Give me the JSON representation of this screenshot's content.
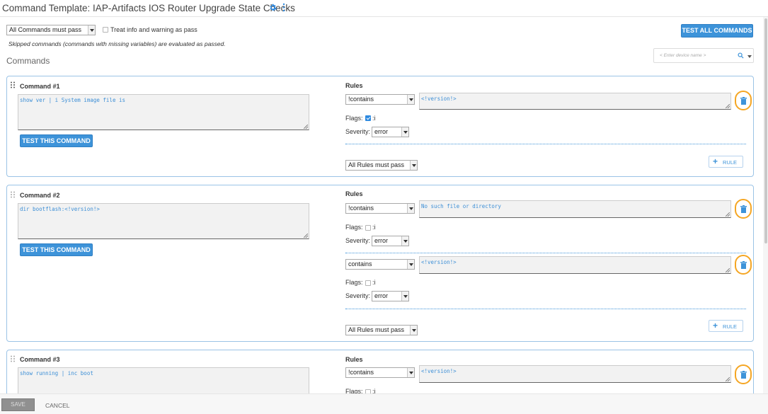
{
  "header": {
    "title": "Command Template: IAP-Artifacts IOS Router Upgrade State Checks"
  },
  "top_controls": {
    "pass_mode": "All Commands must pass",
    "treat_warning_label": "Treat info and warning as pass",
    "treat_warning_checked": false,
    "skipped_note": "Skipped commands (commands with missing variables) are evaluated as passed.",
    "test_all_label": "TEST ALL COMMANDS",
    "device_placeholder": "< Enter device name >"
  },
  "section_title": "Commands",
  "commands": [
    {
      "title": "Command #1",
      "command_text": "show ver | i System image file is",
      "test_label": "TEST THIS COMMAND",
      "rules_label": "Rules",
      "rules": [
        {
          "operator": "!contains",
          "value": "<!version!>",
          "flags_label": "Flags:",
          "flag_i_label": ":i",
          "flag_i_checked": true,
          "severity_label": "Severity:",
          "severity": "error"
        }
      ],
      "rules_pass_mode": "All Rules must pass",
      "add_rule_label": "RULE"
    },
    {
      "title": "Command #2",
      "command_text": "dir bootflash:<!version!>",
      "test_label": "TEST THIS COMMAND",
      "rules_label": "Rules",
      "rules": [
        {
          "operator": "!contains",
          "value": "No such file or directory",
          "flags_label": "Flags:",
          "flag_i_label": ":i",
          "flag_i_checked": false,
          "severity_label": "Severity:",
          "severity": "error"
        },
        {
          "operator": "contains",
          "value": "<!version!>",
          "flags_label": "Flags:",
          "flag_i_label": ":i",
          "flag_i_checked": false,
          "severity_label": "Severity:",
          "severity": "error"
        }
      ],
      "rules_pass_mode": "All Rules must pass",
      "add_rule_label": "RULE"
    },
    {
      "title": "Command #3",
      "command_text": "show running | inc boot",
      "rules_label": "Rules",
      "rules": [
        {
          "operator": "!contains",
          "value": "<!version!>",
          "flags_label": "Flags:",
          "flag_i_label": ":i",
          "flag_i_checked": false
        }
      ]
    }
  ],
  "footer": {
    "save_label": "SAVE",
    "cancel_label": "CANCEL"
  },
  "colors": {
    "accent": "#3d93d9",
    "trash_highlight": "#f5a623",
    "panel_border": "#9bc3e6",
    "code_text": "#3d8fd6"
  },
  "icons": {
    "header": [
      "gear-icon",
      "kebab-menu-icon"
    ],
    "search": [
      "search-icon",
      "chevron-down-icon"
    ],
    "command": [
      "drag-handle-icon",
      "trash-icon",
      "plus-icon"
    ]
  }
}
